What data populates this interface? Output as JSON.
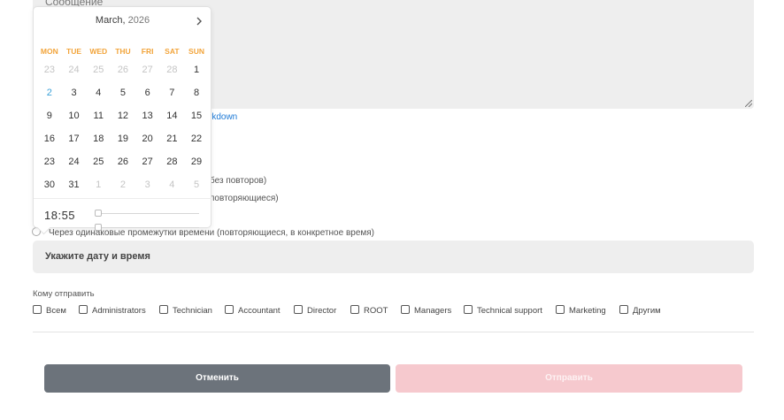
{
  "message": {
    "label": "Сообщение"
  },
  "markdown_link": "rkdown",
  "schedule_options": [
    {
      "label": "без повторов)"
    },
    {
      "label": "повторяющиеся)"
    },
    {
      "label": "Через одинаковые промежутки времени (повторяющиеся, в конкретное время)"
    }
  ],
  "datetime_input": {
    "placeholder": "Укажите дату и время"
  },
  "recipients": {
    "label": "Кому отправить",
    "options": [
      "Всем",
      "Administrators",
      "Technician",
      "Accountant",
      "Director",
      "ROOT",
      "Managers",
      "Technical support",
      "Marketing",
      "Другим"
    ]
  },
  "buttons": {
    "cancel": "Отменить",
    "send": "Отправить"
  },
  "calendar": {
    "month": "March,",
    "year": "2026",
    "weekdays": [
      "MON",
      "TUE",
      "WED",
      "THU",
      "FRI",
      "SAT",
      "SUN"
    ],
    "weeks": [
      [
        {
          "d": "23",
          "m": true
        },
        {
          "d": "24",
          "m": true
        },
        {
          "d": "25",
          "m": true
        },
        {
          "d": "26",
          "m": true
        },
        {
          "d": "27",
          "m": true
        },
        {
          "d": "28",
          "m": true
        },
        {
          "d": "1"
        }
      ],
      [
        {
          "d": "2",
          "t": true
        },
        {
          "d": "3"
        },
        {
          "d": "4"
        },
        {
          "d": "5"
        },
        {
          "d": "6"
        },
        {
          "d": "7"
        },
        {
          "d": "8"
        }
      ],
      [
        {
          "d": "9"
        },
        {
          "d": "10"
        },
        {
          "d": "11"
        },
        {
          "d": "12"
        },
        {
          "d": "13"
        },
        {
          "d": "14"
        },
        {
          "d": "15"
        }
      ],
      [
        {
          "d": "16"
        },
        {
          "d": "17"
        },
        {
          "d": "18"
        },
        {
          "d": "19"
        },
        {
          "d": "20"
        },
        {
          "d": "21"
        },
        {
          "d": "22"
        }
      ],
      [
        {
          "d": "23"
        },
        {
          "d": "24"
        },
        {
          "d": "25"
        },
        {
          "d": "26"
        },
        {
          "d": "27"
        },
        {
          "d": "28"
        },
        {
          "d": "29"
        }
      ],
      [
        {
          "d": "30"
        },
        {
          "d": "31"
        },
        {
          "d": "1",
          "m": true
        },
        {
          "d": "2",
          "m": true
        },
        {
          "d": "3",
          "m": true
        },
        {
          "d": "4",
          "m": true
        },
        {
          "d": "5",
          "m": true
        }
      ]
    ],
    "time": "18:55",
    "hour_slider": 0,
    "minute_slider": 0,
    "colors": {
      "weekday": "#f2a43a",
      "today": "#3ba1d8",
      "muted": "#c4c4c4"
    }
  }
}
